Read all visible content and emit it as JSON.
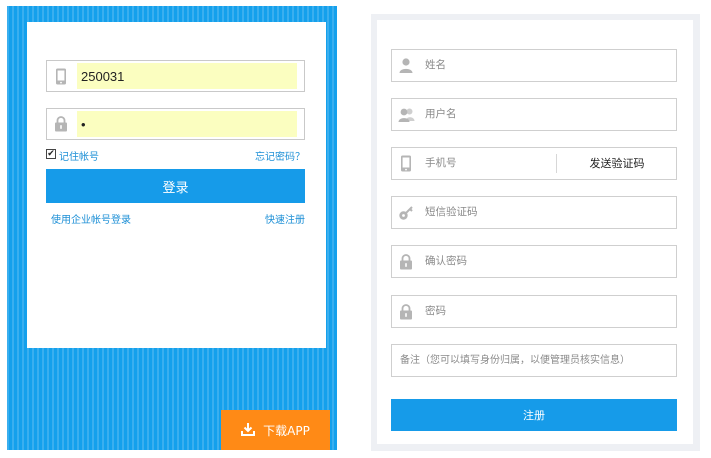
{
  "colors": {
    "primary": "#169be9",
    "panel_bg": "#14a0ec",
    "orange": "#ff8a16",
    "autofill": "#fbfec0",
    "link": "#1c8fd6",
    "icon": "#b5b5b5"
  },
  "login": {
    "account_value": "250031",
    "password_value": "•",
    "remember_checked": true,
    "remember_label": "记住帐号",
    "forgot_label": "忘记密码？",
    "login_button": "登录",
    "enterprise_link": "使用企业帐号登录",
    "quick_register_link": "快速注册",
    "download_app": "下载APP",
    "icons": {
      "account": "phone-icon",
      "password": "lock-icon",
      "download": "download-icon"
    }
  },
  "register": {
    "fields": {
      "name": {
        "placeholder": "姓名",
        "icon": "person-icon"
      },
      "username": {
        "placeholder": "用户名",
        "icon": "users-icon"
      },
      "phone": {
        "placeholder": "手机号",
        "icon": "phone-icon"
      },
      "sms_code": {
        "placeholder": "短信验证码",
        "icon": "key-icon"
      },
      "confirm_password": {
        "placeholder": "确认密码",
        "icon": "lock-icon"
      },
      "password": {
        "placeholder": "密码",
        "icon": "lock-icon"
      },
      "remark": {
        "placeholder": "备注（您可以填写身份归属，以便管理员核实信息）"
      }
    },
    "send_code_button": "发送验证码",
    "register_button": "注册"
  }
}
